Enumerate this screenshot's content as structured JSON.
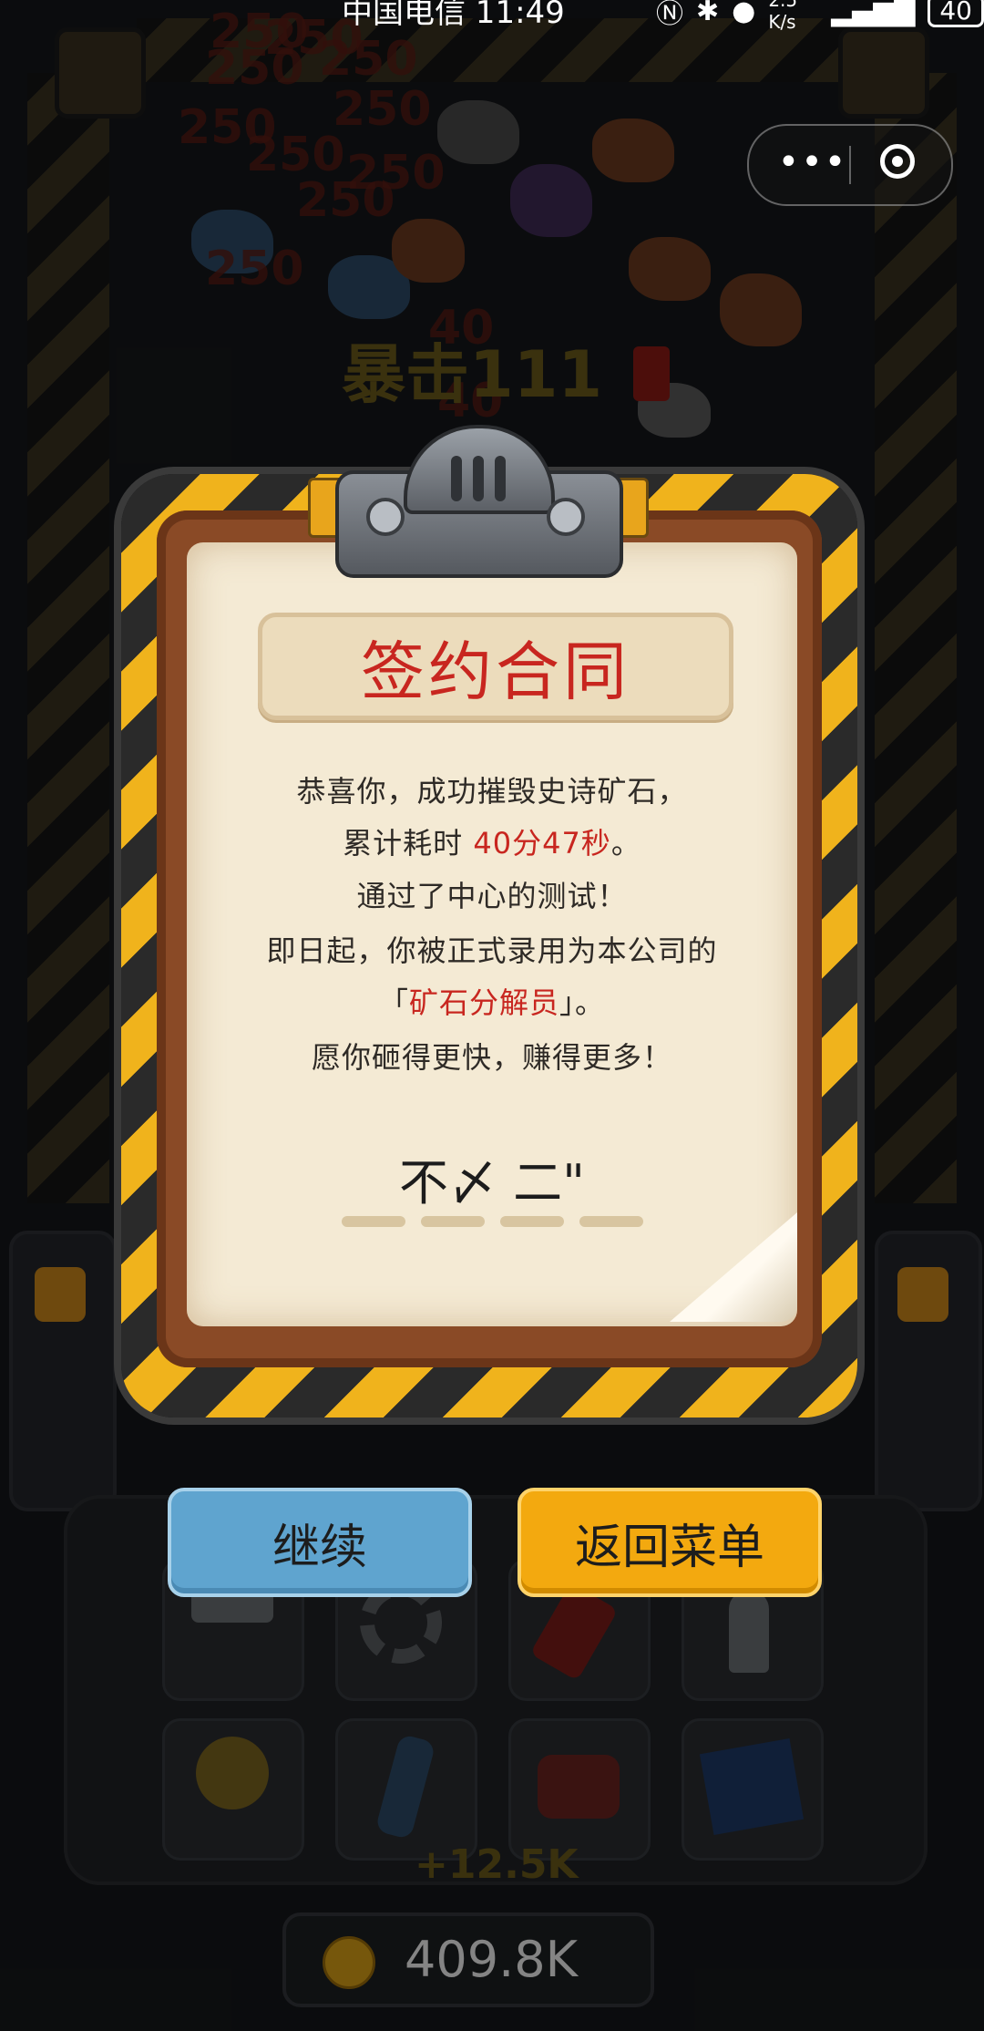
{
  "status_bar": {
    "carrier_time": "中国电信 11:49",
    "net_speed": "2.5 K/s",
    "battery": "40"
  },
  "capsule": {
    "more_icon": "more-dots-icon",
    "close_icon": "target-circle-icon"
  },
  "background": {
    "floating_numbers": [
      "250",
      "250",
      "250",
      "250",
      "250",
      "250",
      "250",
      "250",
      "250",
      "250",
      "40",
      "40"
    ],
    "combo_text": "暴击111",
    "pickup_text": "+12.5K"
  },
  "contract": {
    "title": "签约合同",
    "lines": {
      "line1": "恭喜你，成功摧毁史诗矿石，",
      "line2_prefix": "累计耗时 ",
      "line2_time": "40分47秒",
      "line2_suffix": "。",
      "line3": "通过了中心的测试！",
      "line4": "即日起，你被正式录用为本公司的",
      "line5_open": "「",
      "line5_role": "矿石分解员",
      "line5_close": "」。",
      "line6": "愿你砸得更快，赚得更多！"
    },
    "signature": "不〆 二\""
  },
  "buttons": {
    "continue": "继续",
    "menu": "返回菜单"
  },
  "inventory": {
    "items": [
      "hammer-icon",
      "gear-icon",
      "dynamite-icon",
      "drill-icon",
      "lightbulb-icon",
      "battery-tube-icon",
      "magnet-icon",
      "blueprint-icon"
    ],
    "money": "409.8K"
  },
  "colors": {
    "title_red": "#c8261f",
    "continue_blue": "#5fa4cf",
    "menu_orange": "#f3a90f",
    "hazard_yellow": "#f0b31c"
  }
}
